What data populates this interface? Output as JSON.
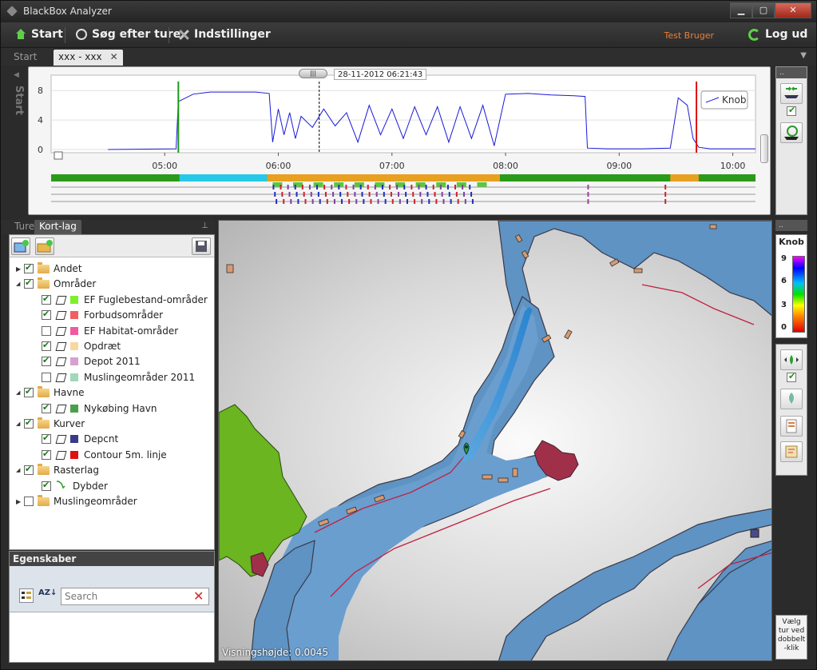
{
  "window": {
    "title": "BlackBox Analyzer",
    "min": "▁",
    "max": "▢",
    "close": "✕"
  },
  "menu": {
    "start": "Start",
    "search_trips": "Søg efter ture",
    "settings": "Indstillinger",
    "user": "Test Bruger",
    "logout": "Log ud"
  },
  "tabs": {
    "start": "Start",
    "trip": "xxx - xxx",
    "close": "✕"
  },
  "side_label": "Start",
  "chart_data": {
    "type": "line",
    "title": "",
    "ylabel": "",
    "xlabel": "",
    "y_ticks": [
      "8",
      "4",
      "0"
    ],
    "ylim": [
      0,
      9
    ],
    "x_ticks": [
      "05:00",
      "06:00",
      "07:00",
      "08:00",
      "09:00",
      "10:00"
    ],
    "cursor_label": "28-11-2012 06:21:43",
    "legend": "Knob",
    "series": [
      {
        "name": "Knob",
        "x": [
          4.5,
          5.1,
          5.12,
          5.25,
          5.4,
          5.6,
          5.8,
          5.92,
          5.95,
          6.0,
          6.05,
          6.1,
          6.15,
          6.2,
          6.3,
          6.4,
          6.5,
          6.6,
          6.7,
          6.8,
          6.9,
          7.0,
          7.1,
          7.2,
          7.3,
          7.4,
          7.5,
          7.6,
          7.7,
          7.8,
          7.9,
          8.0,
          8.2,
          8.4,
          8.6,
          8.7,
          8.72,
          8.9,
          9.2,
          9.45,
          9.52,
          9.6,
          9.65,
          9.7,
          9.8,
          10.2
        ],
        "y": [
          0,
          0.1,
          6.5,
          7.5,
          7.8,
          7.8,
          7.8,
          7.6,
          1.0,
          5.5,
          2.0,
          5.0,
          1.5,
          4.5,
          3.0,
          5.5,
          3.2,
          5.0,
          1.0,
          6.0,
          2.0,
          5.5,
          1.5,
          5.8,
          2.0,
          5.8,
          1.0,
          5.8,
          1.5,
          6.0,
          0.5,
          7.5,
          7.6,
          7.4,
          7.3,
          7.2,
          0.2,
          0.1,
          0.1,
          0.2,
          7.0,
          6.0,
          1.5,
          0.3,
          0.1,
          0.1
        ]
      }
    ],
    "markers": [
      {
        "label": "start",
        "x": 5.12,
        "color": "#1a9a1a"
      },
      {
        "label": "cursor",
        "x": 6.36,
        "color": "#000000"
      },
      {
        "label": "end",
        "x": 9.68,
        "color": "#e01010"
      }
    ]
  },
  "chart_colors": {
    "line": "#1a1ad8",
    "band_green": "#2a9a1a",
    "band_cyan": "#28c8e8"
  },
  "left_tabs": {
    "trips": "Ture",
    "layers": "Kort-lag"
  },
  "layers": {
    "groups": [
      {
        "label": "Andet",
        "checked": true,
        "expanded": false,
        "indent": 0,
        "type": "folder"
      },
      {
        "label": "Områder",
        "checked": true,
        "expanded": true,
        "indent": 0,
        "type": "folder"
      },
      {
        "label": "EF Fuglebestand-områder",
        "checked": true,
        "indent": 1,
        "type": "layer",
        "color": "#7cf02a"
      },
      {
        "label": "Forbudsområder",
        "checked": true,
        "indent": 1,
        "type": "layer",
        "color": "#f06060"
      },
      {
        "label": "EF Habitat-områder",
        "checked": false,
        "indent": 1,
        "type": "layer",
        "color": "#f05aa0"
      },
      {
        "label": "Opdræt",
        "checked": true,
        "indent": 1,
        "type": "layer",
        "color": "#f8d8a0"
      },
      {
        "label": "Depot 2011",
        "checked": true,
        "indent": 1,
        "type": "layer",
        "color": "#d8a0d0"
      },
      {
        "label": "Muslingeområder 2011",
        "checked": false,
        "indent": 1,
        "type": "layer",
        "color": "#a0d8b8"
      },
      {
        "label": "Havne",
        "checked": true,
        "expanded": true,
        "indent": 0,
        "type": "folder"
      },
      {
        "label": "Nykøbing Havn",
        "checked": true,
        "indent": 1,
        "type": "layer",
        "color": "#4aa04a"
      },
      {
        "label": "Kurver",
        "checked": true,
        "expanded": true,
        "indent": 0,
        "type": "folder"
      },
      {
        "label": "Depcnt",
        "checked": true,
        "indent": 1,
        "type": "curve",
        "color": "#3a3a8a"
      },
      {
        "label": "Contour 5m. linje",
        "checked": true,
        "indent": 1,
        "type": "curve",
        "color": "#e01010"
      },
      {
        "label": "Rasterlag",
        "checked": true,
        "expanded": true,
        "indent": 0,
        "type": "folder"
      },
      {
        "label": "Dybder",
        "checked": true,
        "indent": 1,
        "type": "raster",
        "color": ""
      },
      {
        "label": "Muslingeområder",
        "checked": false,
        "expanded": false,
        "indent": 0,
        "type": "folder"
      }
    ]
  },
  "properties": {
    "title": "Egenskaber",
    "sort_label": "AZ↓",
    "search_placeholder": "Search",
    "clear": "✕"
  },
  "map": {
    "status": "Visningshøjde: 0.0045"
  },
  "legend": {
    "title": "Knob",
    "ticks": [
      "9",
      "6",
      "3",
      "0"
    ]
  },
  "select_hint": "Vælg tur ved dobbelt -klik"
}
